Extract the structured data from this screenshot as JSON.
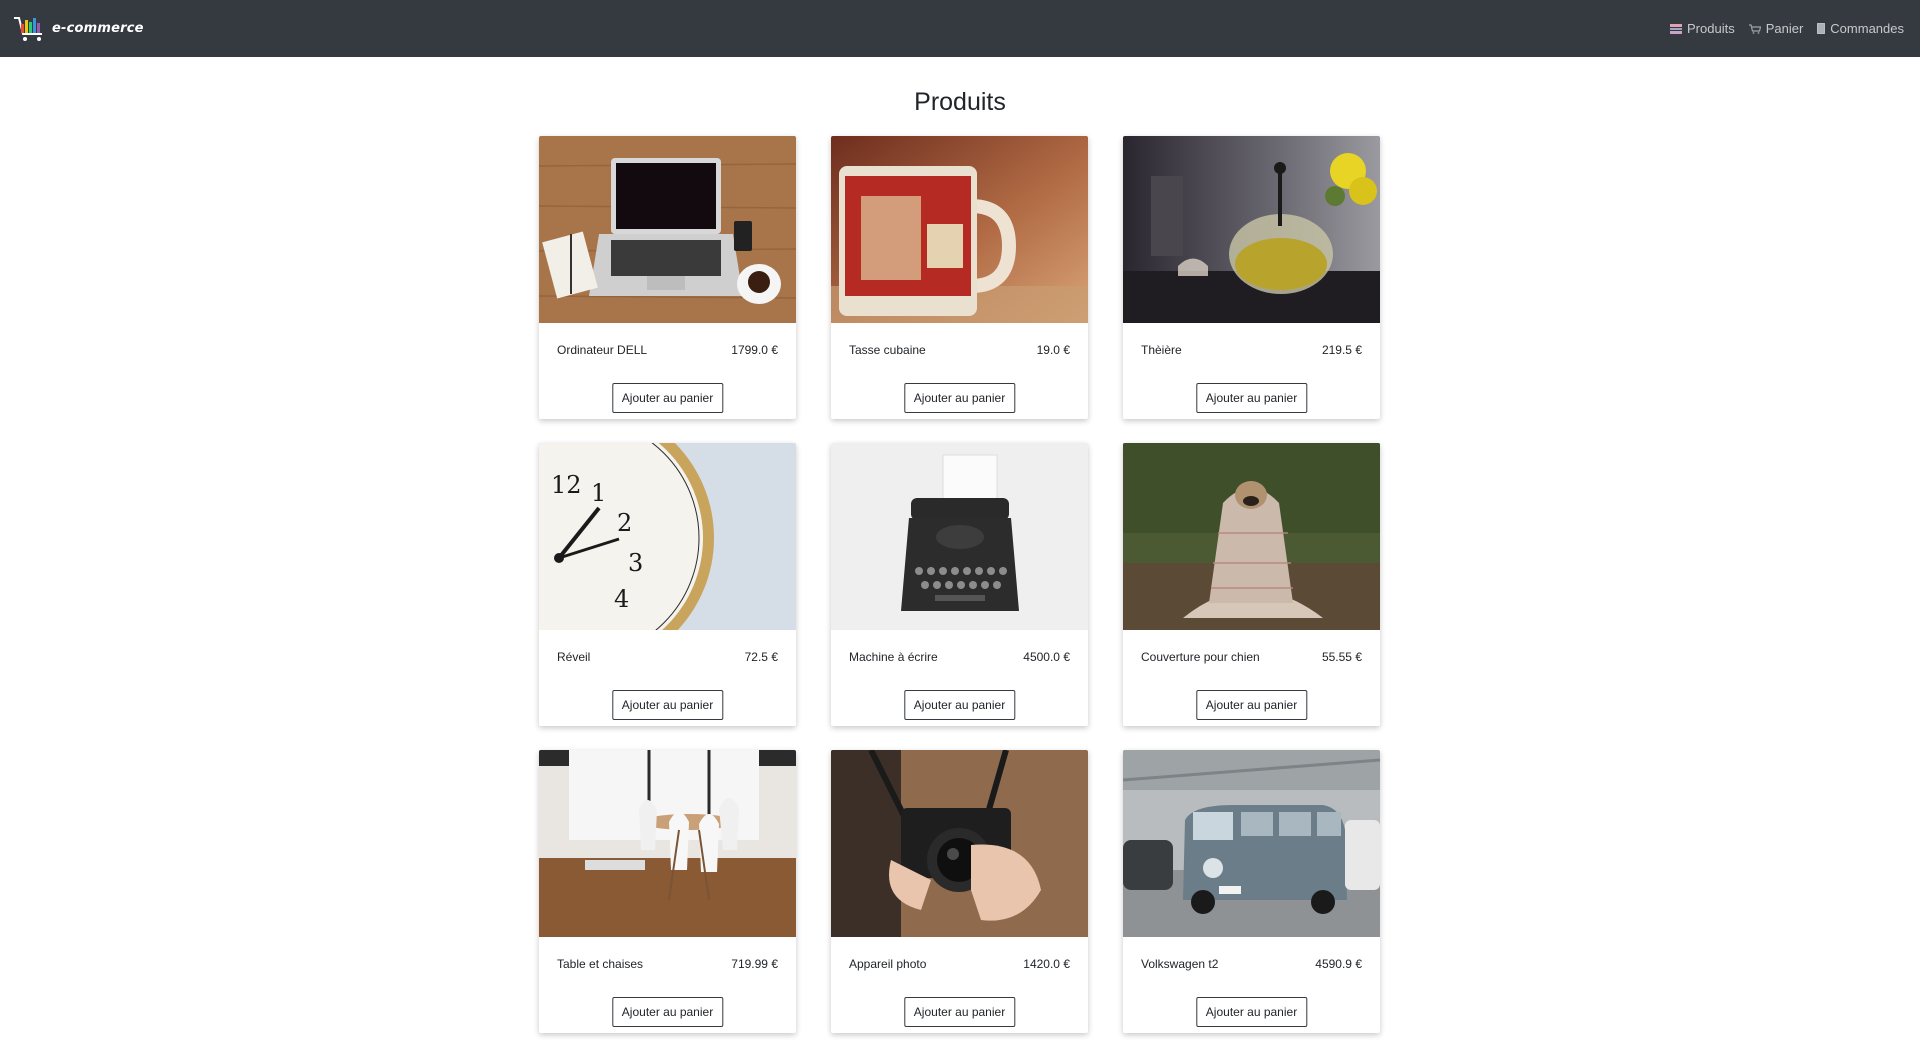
{
  "brand": {
    "name": "e-commerce"
  },
  "nav": [
    {
      "label": "Produits",
      "icon": "products-icon"
    },
    {
      "label": "Panier",
      "icon": "cart-icon"
    },
    {
      "label": "Commandes",
      "icon": "orders-icon"
    }
  ],
  "page": {
    "title": "Produits"
  },
  "products": [
    {
      "name": "Ordinateur DELL",
      "price": "1799.0 €",
      "button": "Ajouter au panier",
      "image": "laptop-on-desk"
    },
    {
      "name": "Tasse cubaine",
      "price": "19.0 €",
      "button": "Ajouter au panier",
      "image": "red-mug"
    },
    {
      "name": "Thèière",
      "price": "219.5 €",
      "button": "Ajouter au panier",
      "image": "teapot"
    },
    {
      "name": "Réveil",
      "price": "72.5 €",
      "button": "Ajouter au panier",
      "image": "alarm-clock"
    },
    {
      "name": "Machine à écrire",
      "price": "4500.0 €",
      "button": "Ajouter au panier",
      "image": "typewriter"
    },
    {
      "name": "Couverture pour chien",
      "price": "55.55 €",
      "button": "Ajouter au panier",
      "image": "dog-blanket"
    },
    {
      "name": "Table et chaises",
      "price": "719.99 €",
      "button": "Ajouter au panier",
      "image": "table-chairs"
    },
    {
      "name": "Appareil photo",
      "price": "1420.0 €",
      "button": "Ajouter au panier",
      "image": "camera"
    },
    {
      "name": "Volkswagen t2",
      "price": "4590.9 €",
      "button": "Ajouter au panier",
      "image": "vw-van"
    }
  ]
}
